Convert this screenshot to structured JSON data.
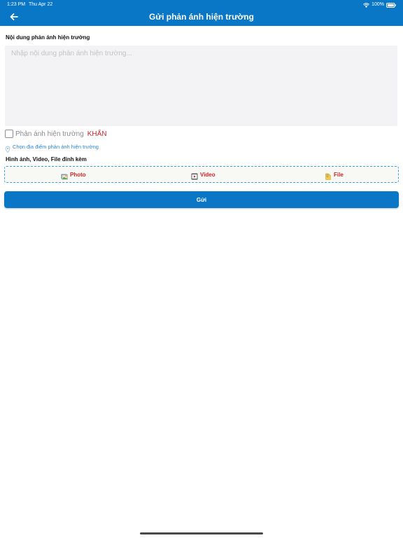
{
  "status_bar": {
    "time": "1:23 PM",
    "date": "Thu Apr 22",
    "battery": "100%",
    "icons": [
      "wifi-icon",
      "battery-icon"
    ]
  },
  "header": {
    "back_icon": "arrow-left-icon",
    "title": "Gửi phản ánh hiện trường"
  },
  "form": {
    "content_label": "Nội dung phản ánh hiện trường",
    "content_placeholder": "Nhập nội dung phản ánh hiện trường...",
    "content_value": "",
    "urgent": {
      "checked": false,
      "label": "Phản ánh hiện trường",
      "tag": "KHẨN"
    },
    "location_icon": "map-pin-icon",
    "location_label": "Chọn địa điểm phản ánh hiện trường",
    "attach_label": "Hình ảnh, Video, File đính kèm",
    "attachments": [
      {
        "icon": "photo-icon",
        "label": "Photo"
      },
      {
        "icon": "video-icon",
        "label": "Video"
      },
      {
        "icon": "file-icon",
        "label": "File"
      }
    ],
    "submit_label": "Gửi"
  },
  "colors": {
    "primary": "#0a77c6",
    "accent_red": "#d0262a",
    "link_blue": "#2a86d1",
    "dashed_border": "#3aa3e0"
  }
}
